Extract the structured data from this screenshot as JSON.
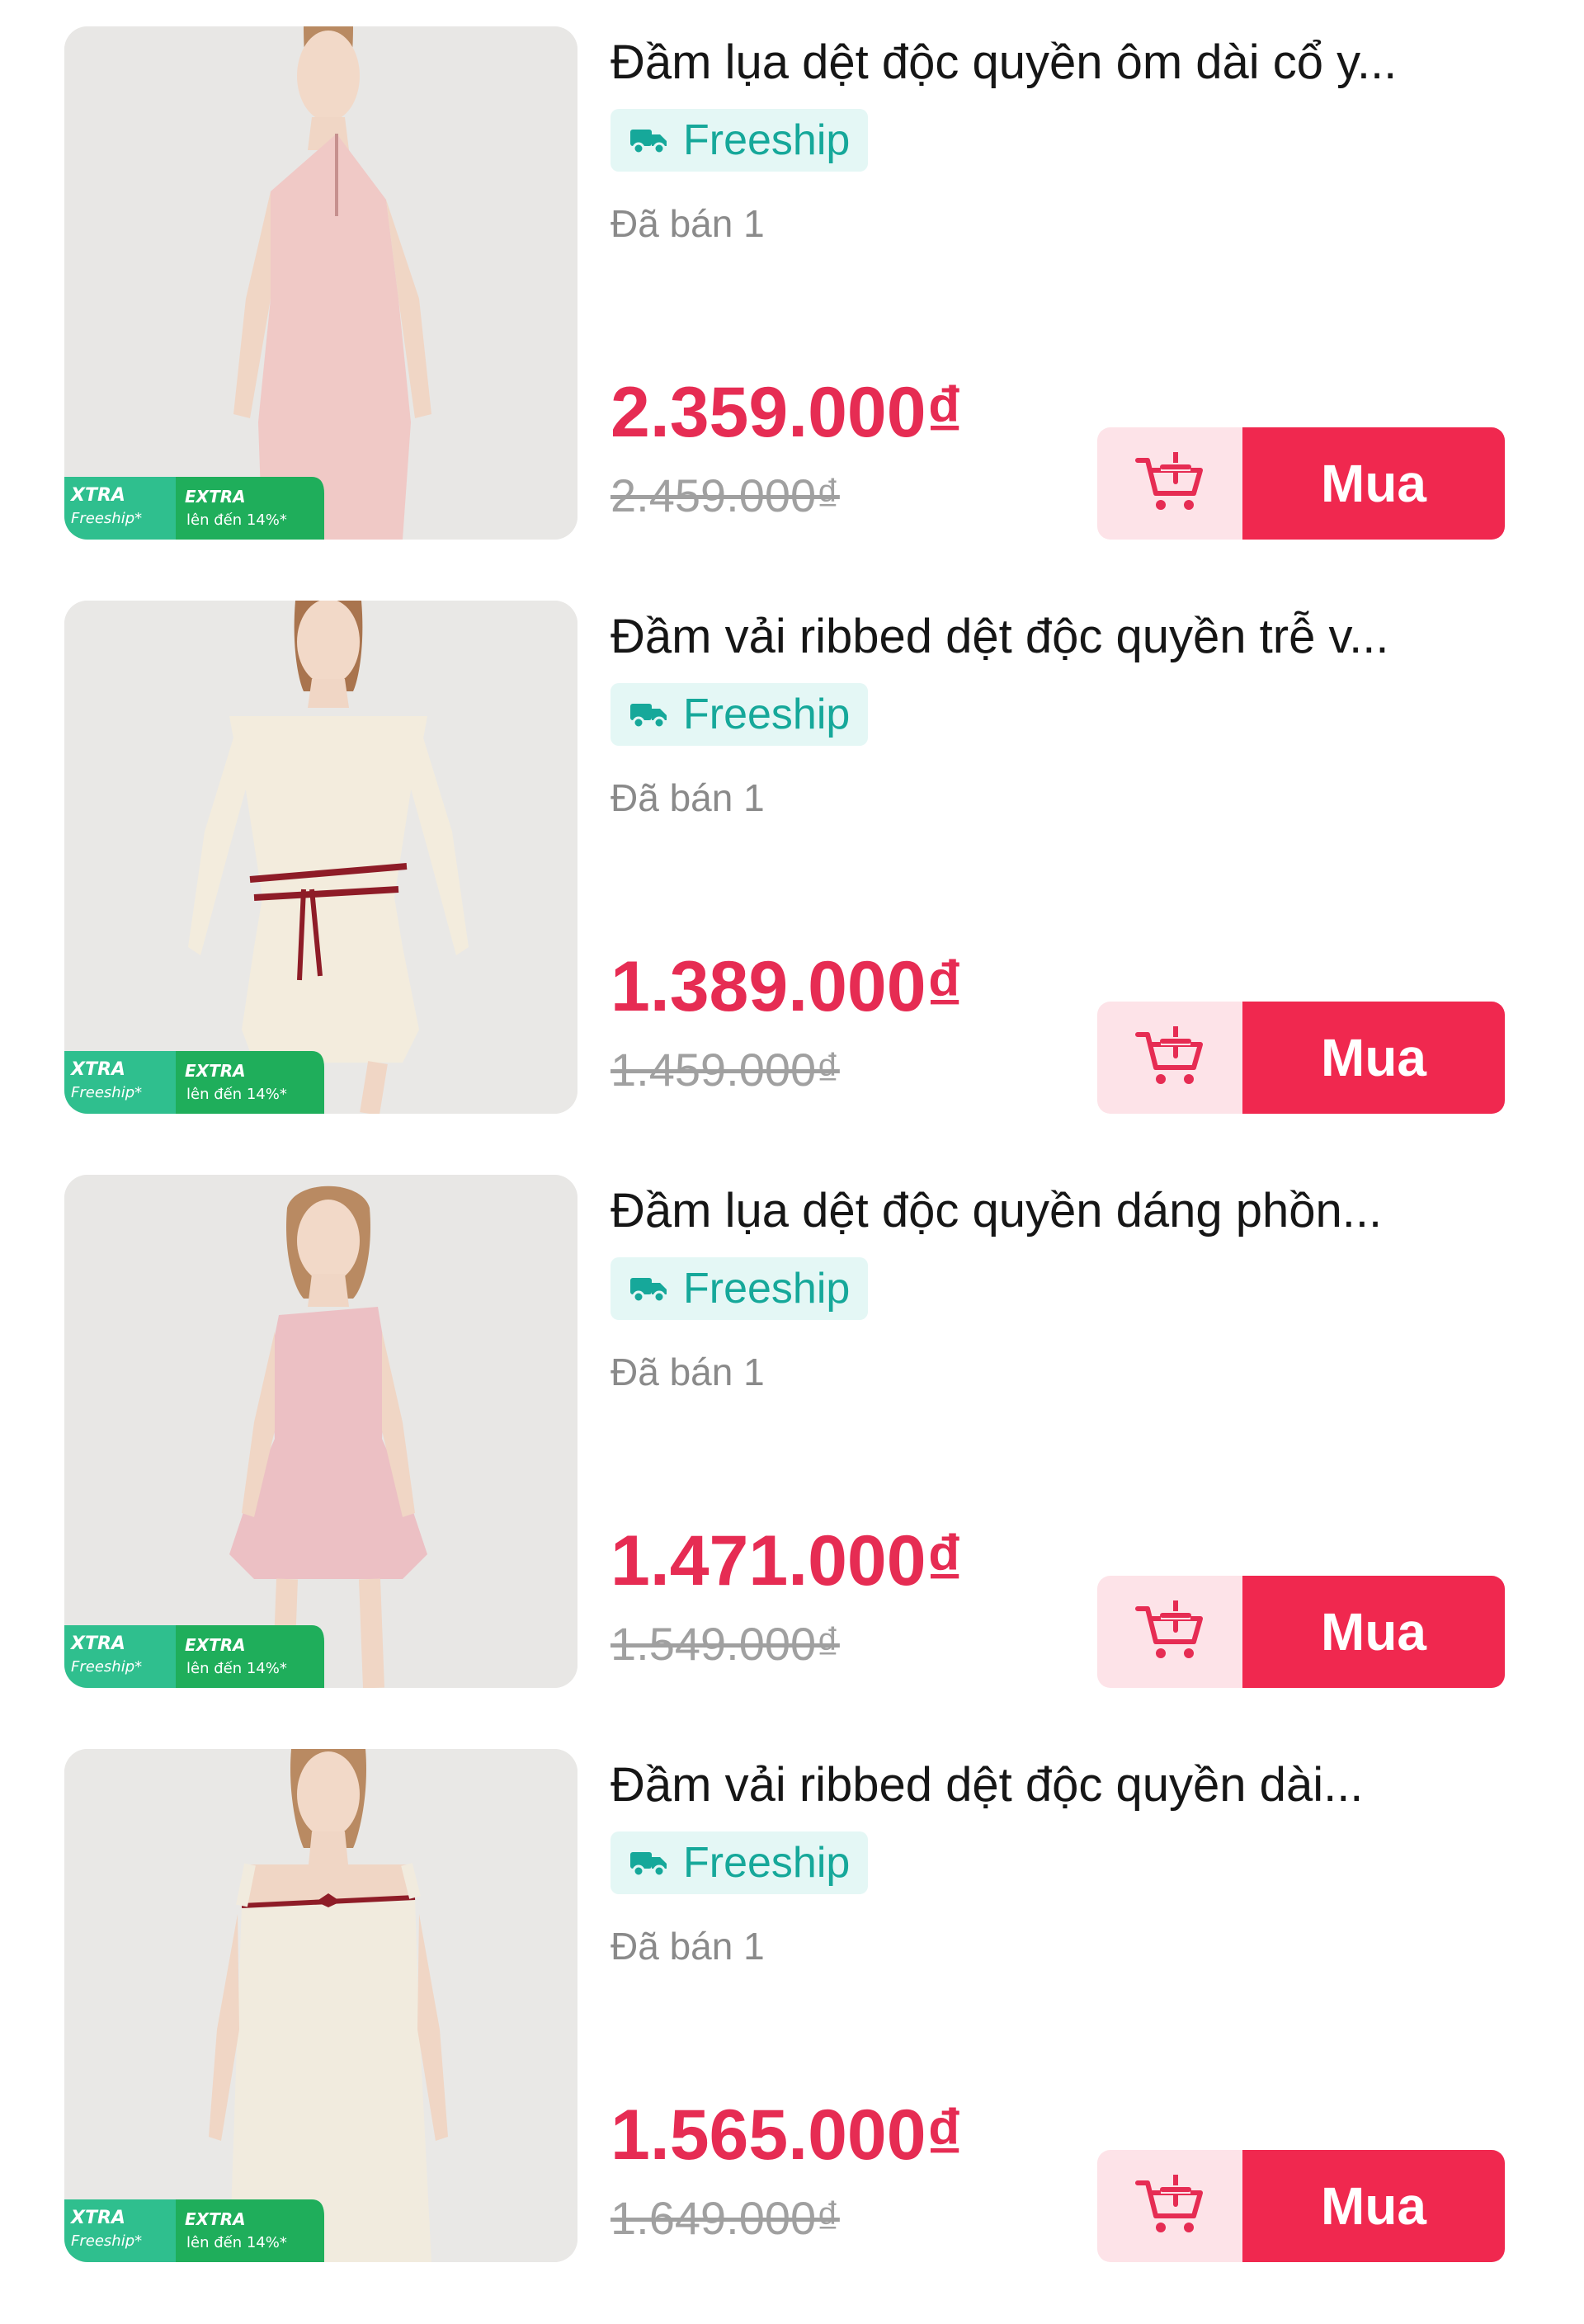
{
  "products": [
    {
      "title": "Đầm lụa dệt độc quyền ôm dài cổ y...",
      "shipping_tag": "Freeship",
      "sold": "Đã bán 1",
      "price": "2.359.000₫",
      "original_price": "2.459.000₫",
      "buy_label": "Mua",
      "dress_color": "#f0c9c6",
      "badge": {
        "xtra": "XTRA",
        "freeship": "Freeship*",
        "extra": "EXTRA",
        "upto": "lên đến 14%*"
      }
    },
    {
      "title": "Đầm vải ribbed dệt độc quyền trễ v...",
      "shipping_tag": "Freeship",
      "sold": "Đã bán 1",
      "price": "1.389.000₫",
      "original_price": "1.459.000₫",
      "buy_label": "Mua",
      "dress_color": "#f3ecdd",
      "badge": {
        "xtra": "XTRA",
        "freeship": "Freeship*",
        "extra": "EXTRA",
        "upto": "lên đến 14%*"
      }
    },
    {
      "title": "Đầm lụa dệt độc quyền dáng phồn...",
      "shipping_tag": "Freeship",
      "sold": "Đã bán 1",
      "price": "1.471.000₫",
      "original_price": "1.549.000₫",
      "buy_label": "Mua",
      "dress_color": "#ecc0c4",
      "badge": {
        "xtra": "XTRA",
        "freeship": "Freeship*",
        "extra": "EXTRA",
        "upto": "lên đến 14%*"
      }
    },
    {
      "title": "Đầm vải ribbed dệt độc quyền dài...",
      "shipping_tag": "Freeship",
      "sold": "Đã bán 1",
      "price": "1.565.000₫",
      "original_price": "1.649.000₫",
      "buy_label": "Mua",
      "dress_color": "#f1ebde",
      "badge": {
        "xtra": "XTRA",
        "freeship": "Freeship*",
        "extra": "EXTRA",
        "upto": "lên đến 14%*"
      }
    }
  ],
  "colors": {
    "price_red": "#e62c53",
    "buy_button": "#f0284f",
    "cart_button_bg": "#fde3e8",
    "freeship_teal": "#16a89a",
    "freeship_bg": "#e4f7f5",
    "badge_green": "#1fae5b"
  },
  "icons": {
    "freeship": "truck-icon",
    "cart": "add-to-cart-icon"
  }
}
